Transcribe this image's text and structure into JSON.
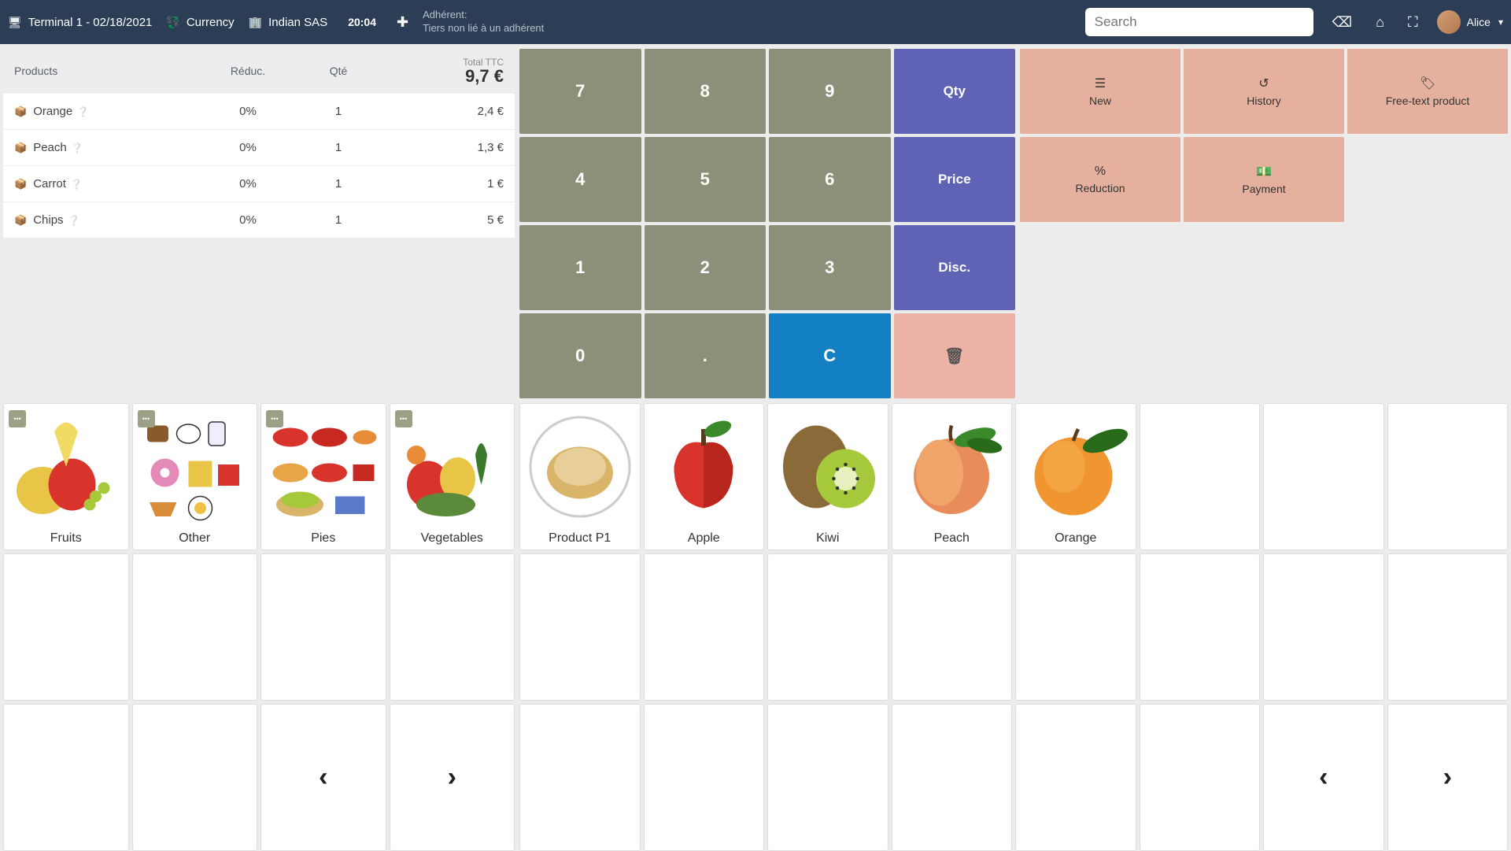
{
  "topbar": {
    "terminal": "Terminal 1 - 02/18/2021",
    "currency": "Currency",
    "company": "Indian SAS",
    "time": "20:04",
    "adherent_label": "Adhérent:",
    "adherent_sub": "Tiers non lié à un adhérent",
    "search_placeholder": "Search",
    "user": "Alice"
  },
  "invoice": {
    "header": {
      "products": "Products",
      "reduc": "Réduc.",
      "qte": "Qté",
      "total_label": "Total TTC",
      "total_val": "9,7 €"
    },
    "rows": [
      {
        "name": "Orange",
        "reduc": "0%",
        "qte": "1",
        "total": "2,4 €"
      },
      {
        "name": "Peach",
        "reduc": "0%",
        "qte": "1",
        "total": "1,3 €"
      },
      {
        "name": "Carrot",
        "reduc": "0%",
        "qte": "1",
        "total": "1 €"
      },
      {
        "name": "Chips",
        "reduc": "0%",
        "qte": "1",
        "total": "5 €"
      }
    ]
  },
  "keypad": {
    "k7": "7",
    "k8": "8",
    "k9": "9",
    "qty": "Qty",
    "k4": "4",
    "k5": "5",
    "k6": "6",
    "price": "Price",
    "k1": "1",
    "k2": "2",
    "k3": "3",
    "disc": "Disc.",
    "k0": "0",
    "dot": ".",
    "c": "C"
  },
  "actions": {
    "new": "New",
    "history": "History",
    "freetext": "Free-text product",
    "reduction": "Reduction",
    "payment": "Payment"
  },
  "categories": [
    "Fruits",
    "Other",
    "Pies",
    "Vegetables"
  ],
  "products": [
    "Product P1",
    "Apple",
    "Kiwi",
    "Peach",
    "Orange"
  ]
}
